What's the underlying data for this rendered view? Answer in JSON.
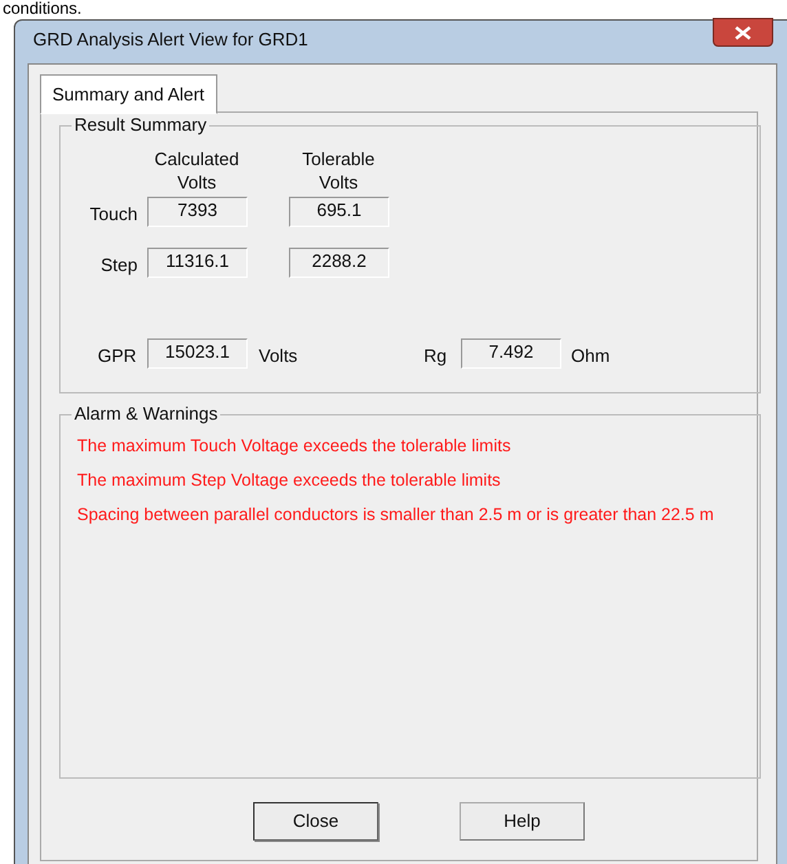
{
  "page_text": "conditions.",
  "window": {
    "title": "GRD Analysis Alert View for GRD1"
  },
  "tabs": [
    {
      "label": "Summary and Alert",
      "selected": true
    }
  ],
  "result_summary": {
    "title": "Result Summary",
    "column_headers": [
      "Calculated\nVolts",
      "Tolerable\nVolts"
    ],
    "rows": [
      {
        "label": "Touch",
        "calculated": "7393",
        "tolerable": "695.1"
      },
      {
        "label": "Step",
        "calculated": "11316.1",
        "tolerable": "2288.2"
      }
    ],
    "gpr": {
      "label": "GPR",
      "value": "15023.1",
      "unit": "Volts"
    },
    "rg": {
      "label": "Rg",
      "value": "7.492",
      "unit": "Ohm"
    }
  },
  "alarms": {
    "title": "Alarm & Warnings",
    "messages": [
      "The maximum Touch Voltage exceeds the tolerable limits",
      "The maximum Step Voltage exceeds the tolerable limits",
      "Spacing between parallel conductors is smaller than 2.5 m or is greater than 22.5 m"
    ]
  },
  "buttons": [
    "Close",
    "Help"
  ]
}
